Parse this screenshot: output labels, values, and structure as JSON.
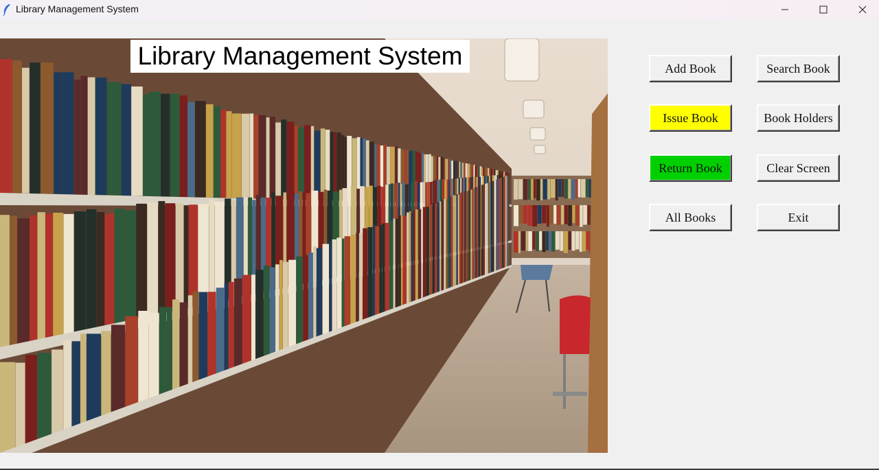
{
  "window": {
    "title": "Library Management System",
    "icon": "feather-icon",
    "controls": [
      "minimize-icon",
      "maximize-icon",
      "close-icon"
    ]
  },
  "banner": {
    "text": "Library Management System"
  },
  "buttons": {
    "add_book": {
      "label": "Add Book",
      "color": "#f0f0f0"
    },
    "search_book": {
      "label": "Search Book",
      "color": "#f0f0f0"
    },
    "issue_book": {
      "label": "Issue Book",
      "color": "#ffff00"
    },
    "book_holders": {
      "label": "Book Holders",
      "color": "#f0f0f0"
    },
    "return_book": {
      "label": "Return Book",
      "color": "#00d000"
    },
    "clear_screen": {
      "label": "Clear Screen",
      "color": "#f0f0f0"
    },
    "all_books": {
      "label": "All Books",
      "color": "#f0f0f0"
    },
    "exit": {
      "label": "Exit",
      "color": "#f0f0f0"
    }
  },
  "background_image": "library-bookshelves-photo"
}
